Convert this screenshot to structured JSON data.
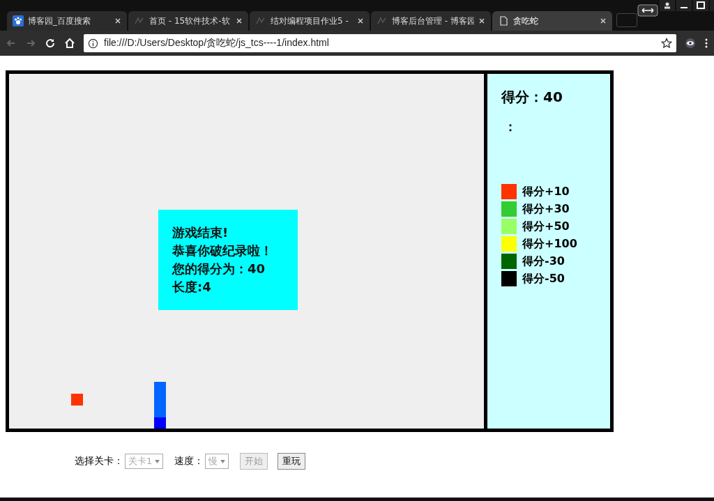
{
  "tabs": [
    {
      "label": "博客园_百度搜索",
      "selected": false
    },
    {
      "label": "首页 - 15软件技术-软",
      "selected": false
    },
    {
      "label": "结对编程项目作业5 - ",
      "selected": false
    },
    {
      "label": "博客后台管理 - 博客园",
      "selected": false
    },
    {
      "label": "贪吃蛇",
      "selected": true
    }
  ],
  "address": "file:///D:/Users/Desktop/贪吃蛇/js_tcs----1/index.html",
  "game": {
    "food": {
      "color": "#ff3300"
    },
    "snake": [
      {
        "kind": "head"
      },
      {
        "kind": "body"
      },
      {
        "kind": "body"
      },
      {
        "kind": "body"
      }
    ],
    "message": [
      "游戏结束!",
      "恭喜你破纪录啦！",
      "您的得分为：40",
      "长度:4"
    ]
  },
  "panel": {
    "score": "得分：40",
    "record": "：",
    "legend": [
      {
        "label": "得分+10",
        "color": "#ff3300"
      },
      {
        "label": "得分+30",
        "color": "#33cc33"
      },
      {
        "label": "得分+50",
        "color": "#99ff66"
      },
      {
        "label": "得分+100",
        "color": "#ffff00"
      },
      {
        "label": "得分-30",
        "color": "#006600"
      },
      {
        "label": "得分-50",
        "color": "#000000"
      }
    ]
  },
  "controls": {
    "level_label": "选择关卡：",
    "level": {
      "value": "关卡1",
      "disabled": true
    },
    "speed_label": "速度：",
    "speed": {
      "value": "慢",
      "disabled": true
    },
    "buttons": [
      {
        "label": "开始",
        "disabled": true
      },
      {
        "label": "重玩",
        "disabled": false
      }
    ]
  }
}
